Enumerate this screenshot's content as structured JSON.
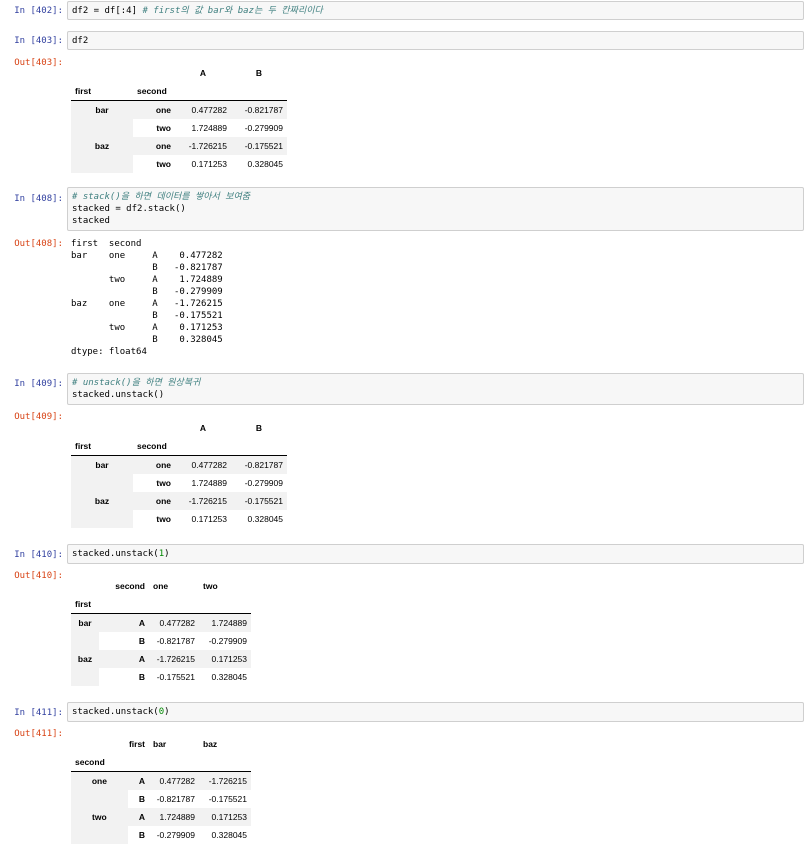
{
  "cells": [
    {
      "in_prompt": "In [402]:",
      "code_parts": [
        "df2 = df[:4] ",
        "# first의 값 bar와 baz는 두 칸짜리이다"
      ]
    },
    {
      "in_prompt": "In [403]:",
      "code_parts": [
        "df2"
      ],
      "out_prompt": "Out[403]:",
      "table": {
        "cols": [
          "A",
          "B"
        ],
        "index_names": [
          "first",
          "second"
        ],
        "rows": [
          {
            "lvl0": "bar",
            "lvl1": "one",
            "vals": [
              "0.477282",
              "-0.821787"
            ]
          },
          {
            "lvl0": "",
            "lvl1": "two",
            "vals": [
              "1.724889",
              "-0.279909"
            ]
          },
          {
            "lvl0": "baz",
            "lvl1": "one",
            "vals": [
              "-1.726215",
              "-0.175521"
            ]
          },
          {
            "lvl0": "",
            "lvl1": "two",
            "vals": [
              "0.171253",
              "0.328045"
            ]
          }
        ]
      }
    },
    {
      "in_prompt": "In [408]:",
      "code_lines": [
        "# stack()을 하면 데이터를 쌓아서 보여줌",
        "stacked = df2.stack()",
        "stacked"
      ],
      "out_prompt": "Out[408]:",
      "text_output": "first  second\nbar    one     A    0.477282\n               B   -0.821787\n       two     A    1.724889\n               B   -0.279909\nbaz    one     A   -1.726215\n               B   -0.175521\n       two     A    0.171253\n               B    0.328045\ndtype: float64"
    },
    {
      "in_prompt": "In [409]:",
      "code_lines": [
        "# unstack()을 하면 원상복귀",
        "stacked.unstack()"
      ],
      "out_prompt": "Out[409]:",
      "table": {
        "cols": [
          "A",
          "B"
        ],
        "index_names": [
          "first",
          "second"
        ],
        "rows": [
          {
            "lvl0": "bar",
            "lvl1": "one",
            "vals": [
              "0.477282",
              "-0.821787"
            ]
          },
          {
            "lvl0": "",
            "lvl1": "two",
            "vals": [
              "1.724889",
              "-0.279909"
            ]
          },
          {
            "lvl0": "baz",
            "lvl1": "one",
            "vals": [
              "-1.726215",
              "-0.175521"
            ]
          },
          {
            "lvl0": "",
            "lvl1": "two",
            "vals": [
              "0.171253",
              "0.328045"
            ]
          }
        ]
      }
    },
    {
      "in_prompt": "In [410]:",
      "code_parts": [
        "stacked.unstack(",
        "1",
        ")"
      ],
      "out_prompt": "Out[410]:",
      "table": {
        "col_level_name": "second",
        "cols": [
          "one",
          "two"
        ],
        "index_name": "first",
        "rows": [
          {
            "lvl0": "bar",
            "lvl1": "A",
            "vals": [
              "0.477282",
              "1.724889"
            ]
          },
          {
            "lvl0": "",
            "lvl1": "B",
            "vals": [
              "-0.821787",
              "-0.279909"
            ]
          },
          {
            "lvl0": "baz",
            "lvl1": "A",
            "vals": [
              "-1.726215",
              "0.171253"
            ]
          },
          {
            "lvl0": "",
            "lvl1": "B",
            "vals": [
              "-0.175521",
              "0.328045"
            ]
          }
        ]
      }
    },
    {
      "in_prompt": "In [411]:",
      "code_parts": [
        "stacked.unstack(",
        "0",
        ")"
      ],
      "out_prompt": "Out[411]:",
      "table": {
        "col_level_name": "first",
        "cols": [
          "bar",
          "baz"
        ],
        "index_name": "second",
        "rows": [
          {
            "lvl0": "one",
            "lvl1": "A",
            "vals": [
              "0.477282",
              "-1.726215"
            ]
          },
          {
            "lvl0": "",
            "lvl1": "B",
            "vals": [
              "-0.821787",
              "-0.175521"
            ]
          },
          {
            "lvl0": "two",
            "lvl1": "A",
            "vals": [
              "1.724889",
              "0.171253"
            ]
          },
          {
            "lvl0": "",
            "lvl1": "B",
            "vals": [
              "-0.279909",
              "0.328045"
            ]
          }
        ]
      }
    }
  ],
  "colors": {
    "in_prompt": "#303f9f",
    "out_prompt": "#d84315",
    "cell_bg": "#f7f7f7",
    "cell_border": "#cfcfcf",
    "comment": "#408080"
  }
}
